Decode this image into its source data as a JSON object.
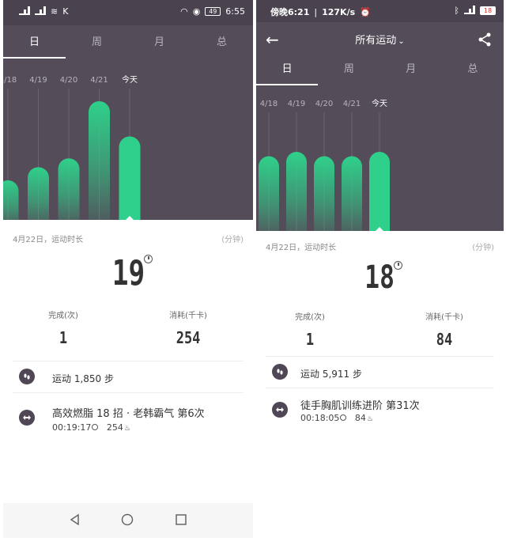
{
  "left": {
    "status": {
      "left_text": "HD 4G 4G",
      "time": "6:55",
      "battery": "49"
    },
    "tabs": [
      {
        "label": "日",
        "active": true
      },
      {
        "label": "周",
        "active": false
      },
      {
        "label": "月",
        "active": false
      },
      {
        "label": "总",
        "active": false
      }
    ],
    "chart_dates": [
      "4/18",
      "4/19",
      "4/20",
      "4/21",
      "今天"
    ],
    "chart_values": [
      9,
      12,
      14,
      27,
      19
    ],
    "date_label": "4月22日，运动时长",
    "unit_label": "(分钟)",
    "minutes": "19",
    "stats": {
      "done_label": "完成(次)",
      "done_value": "1",
      "kcal_label": "消耗(千卡)",
      "kcal_value": "254"
    },
    "steps": "运动 1,850 步",
    "workout_title": "高效燃脂 18 招 · 老韩霸气 第6次",
    "workout_duration": "00:19:17",
    "workout_kcal": "254"
  },
  "right": {
    "status": {
      "time": "傍晚6:21",
      "speed": "127K/s",
      "battery": "18"
    },
    "header_title": "所有运动",
    "tabs": [
      {
        "label": "日",
        "active": true
      },
      {
        "label": "周",
        "active": false
      },
      {
        "label": "月",
        "active": false
      },
      {
        "label": "总",
        "active": false
      }
    ],
    "chart_dates": [
      "4/18",
      "4/19",
      "4/20",
      "4/21",
      "今天"
    ],
    "chart_values": [
      17,
      18,
      17,
      17,
      18
    ],
    "date_label": "4月22日，运动时长",
    "unit_label": "(分钟)",
    "minutes": "18",
    "stats": {
      "done_label": "完成(次)",
      "done_value": "1",
      "kcal_label": "消耗(千卡)",
      "kcal_value": "84"
    },
    "steps": "运动 5,911 步",
    "workout_title": "徒手胸肌训练进阶 第31次",
    "workout_duration": "00:18:05",
    "workout_kcal": "84"
  },
  "colors": {
    "header_bg": "#544c58",
    "status_bg": "#4a424e",
    "bar_green": "#2fd08b",
    "icon_bg": "#4f4756"
  }
}
